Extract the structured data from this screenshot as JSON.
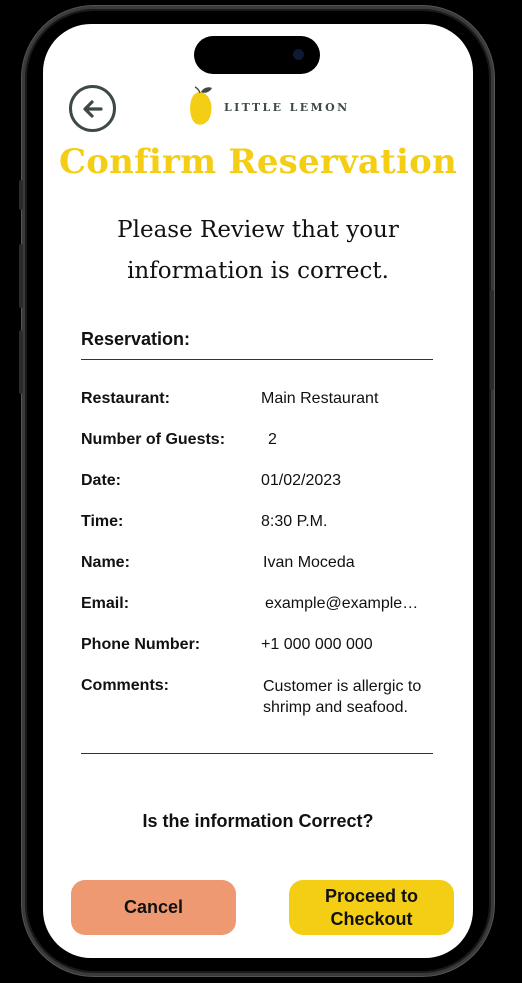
{
  "header": {
    "brand_name": "LITTLE LEMON",
    "back_icon": "arrow-left-circle-icon"
  },
  "page": {
    "title": "Confirm Reservation",
    "subtitle": "Please Review that your information is correct."
  },
  "reservation": {
    "section_label": "Reservation:",
    "rows": [
      {
        "label": "Restaurant:",
        "value": "Main Restaurant"
      },
      {
        "label": "Number of Guests:",
        "value": "2"
      },
      {
        "label": "Date:",
        "value": "01/02/2023"
      },
      {
        "label": "Time:",
        "value": "8:30 P.M."
      },
      {
        "label": "Name:",
        "value": "Ivan Moceda"
      },
      {
        "label": "Email:",
        "value": "example@example…"
      },
      {
        "label": "Phone Number:",
        "value": "+1 000 000 000"
      },
      {
        "label": "Comments:",
        "value": "Customer is allergic to shrimp and seafood."
      }
    ]
  },
  "confirm": {
    "question": "Is the information Correct?",
    "cancel_label": "Cancel",
    "proceed_label": "Proceed to Checkout"
  },
  "colors": {
    "primary_yellow": "#f4ce14",
    "cancel_salmon": "#ee9972",
    "brand_green": "#3f4a45"
  }
}
